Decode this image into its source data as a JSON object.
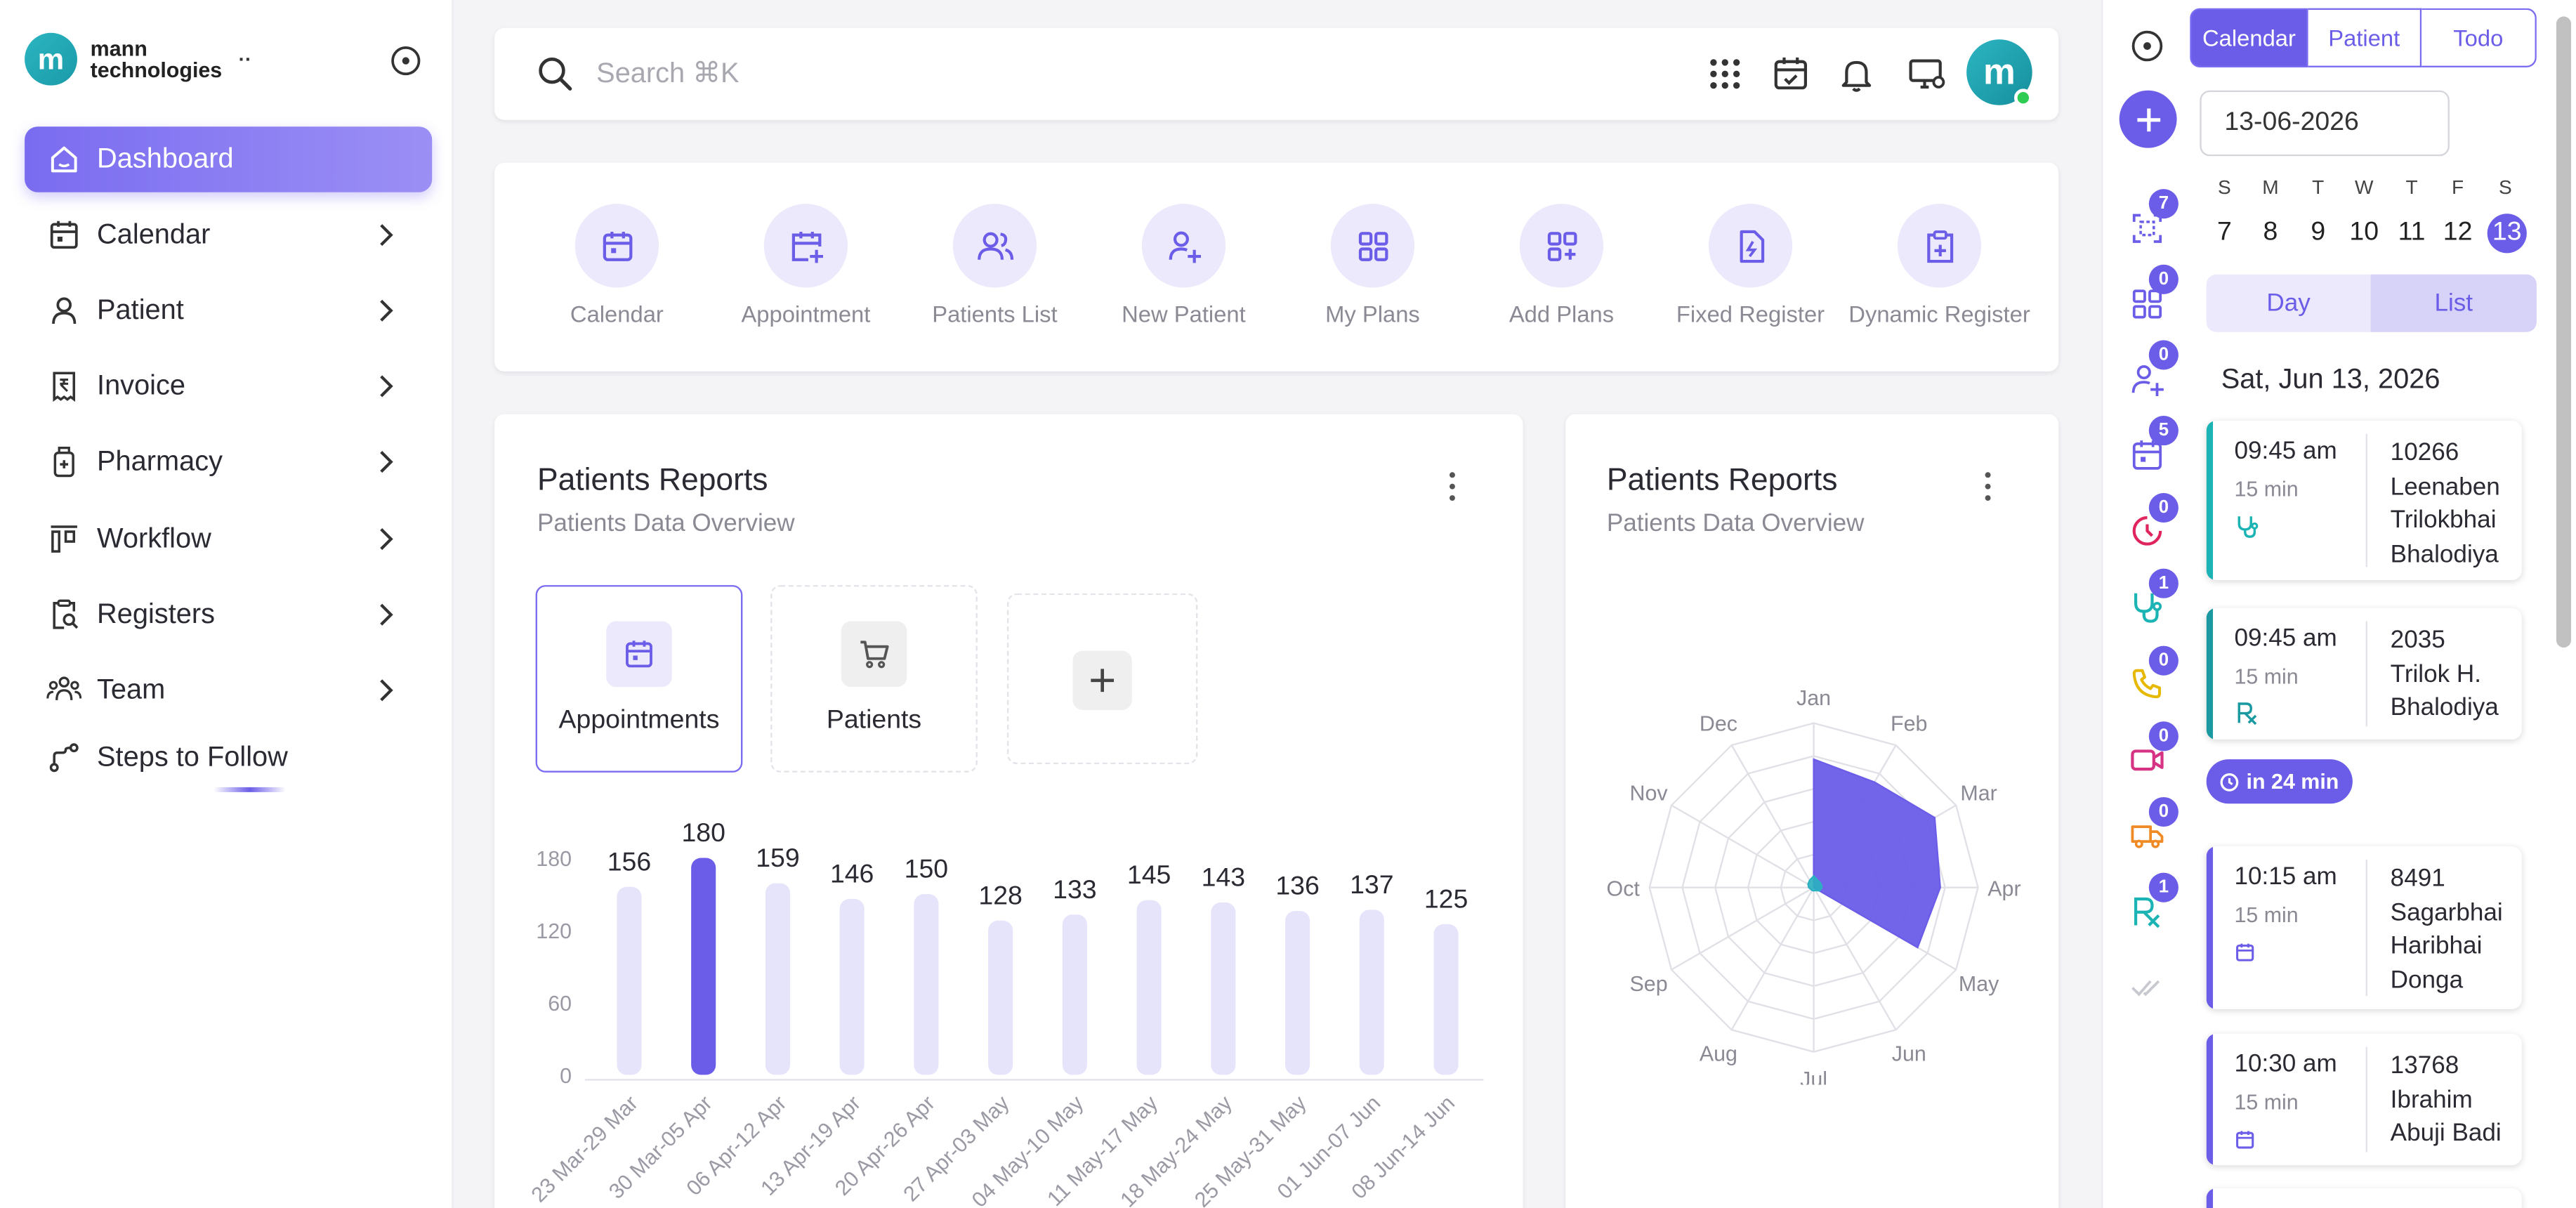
{
  "brand": {
    "logo_letter": "m",
    "name_line1": "mann",
    "name_line2": "technologies",
    "dots": "··"
  },
  "sidebar": {
    "items": [
      {
        "label": "Dashboard",
        "icon": "home-icon"
      },
      {
        "label": "Calendar",
        "icon": "calendar-icon"
      },
      {
        "label": "Patient",
        "icon": "user-icon"
      },
      {
        "label": "Invoice",
        "icon": "invoice-icon"
      },
      {
        "label": "Pharmacy",
        "icon": "pill-bottle-icon"
      },
      {
        "label": "Workflow",
        "icon": "workflow-icon"
      },
      {
        "label": "Registers",
        "icon": "clipboard-search-icon"
      },
      {
        "label": "Team",
        "icon": "team-icon"
      },
      {
        "label": "Steps to Follow",
        "icon": "route-icon"
      }
    ]
  },
  "search": {
    "placeholder": "Search ⌘K"
  },
  "user": {
    "avatar_letter": "m"
  },
  "quick_actions": [
    {
      "label": "Calendar",
      "icon": "calendar-icon"
    },
    {
      "label": "Appointment",
      "icon": "calendar-plus-icon"
    },
    {
      "label": "Patients List",
      "icon": "users-icon"
    },
    {
      "label": "New Patient",
      "icon": "user-plus-icon"
    },
    {
      "label": "My Plans",
      "icon": "grid-icon"
    },
    {
      "label": "Add Plans",
      "icon": "grid-plus-icon"
    },
    {
      "label": "Fixed Register",
      "icon": "file-bolt-icon"
    },
    {
      "label": "Dynamic Register",
      "icon": "clipboard-plus-icon"
    }
  ],
  "reports_card": {
    "title": "Patients Reports",
    "subtitle": "Patients Data Overview",
    "tabs": [
      {
        "label": "Appointments",
        "icon": "calendar-icon"
      },
      {
        "label": "Patients",
        "icon": "cart-icon"
      }
    ]
  },
  "radar_card": {
    "title": "Patients Reports",
    "subtitle": "Patients Data Overview"
  },
  "chart_data": [
    {
      "type": "bar",
      "categories": [
        "23 Mar-29 Mar",
        "30 Mar-05 Apr",
        "06 Apr-12 Apr",
        "13 Apr-19 Apr",
        "20 Apr-26 Apr",
        "27 Apr-03 May",
        "04 May-10 May",
        "11 May-17 May",
        "18 May-24 May",
        "25 May-31 May",
        "01 Jun-07 Jun",
        "08 Jun-14 Jun"
      ],
      "values": [
        156,
        180,
        159,
        146,
        150,
        128,
        133,
        145,
        143,
        136,
        137,
        125
      ],
      "highlight_index": 1,
      "yticks": [
        0,
        60,
        120,
        180
      ],
      "ylim": [
        0,
        180
      ],
      "colors": {
        "bar": "#e6e4fa",
        "highlight": "#6b5de8"
      }
    },
    {
      "type": "radar",
      "categories": [
        "Jan",
        "Feb",
        "Mar",
        "Apr",
        "May",
        "Jun",
        "Jul",
        "Aug",
        "Sep",
        "Oct",
        "Nov",
        "Dec"
      ],
      "series": [
        {
          "values": [
            0.78,
            0.74,
            0.85,
            0.77,
            0.73,
            0,
            0,
            0,
            0,
            0,
            0,
            0
          ],
          "color": "#6b5de8"
        },
        {
          "values": [
            0.07,
            0.05,
            0.05,
            0.05,
            0.04,
            0.02,
            0.02,
            0.02,
            0.02,
            0.03,
            0.04,
            0.05
          ],
          "color": "#2ab0c0"
        }
      ]
    }
  ],
  "right_panel": {
    "tabs": [
      "Calendar",
      "Patient",
      "Todo"
    ],
    "date_value": "13-06-2026",
    "weekdays": [
      "S",
      "M",
      "T",
      "W",
      "T",
      "F",
      "S"
    ],
    "days": [
      "7",
      "8",
      "9",
      "10",
      "11",
      "12",
      "13"
    ],
    "view_tabs": [
      "Day",
      "List"
    ],
    "date_heading": "Sat, Jun 13, 2026",
    "side_icons": [
      {
        "icon": "scan-icon",
        "count": "7",
        "color": "#6b5de8"
      },
      {
        "icon": "grid-icon",
        "count": "0",
        "color": "#6b5de8"
      },
      {
        "icon": "user-plus-icon",
        "count": "0",
        "color": "#6b5de8"
      },
      {
        "icon": "calendar-icon",
        "count": "5",
        "color": "#6b5de8"
      },
      {
        "icon": "timer-icon",
        "count": "0",
        "color": "#e0245e"
      },
      {
        "icon": "stethoscope-icon",
        "count": "1",
        "color": "#1bb3b3"
      },
      {
        "icon": "phone-icon",
        "count": "0",
        "color": "#e6b800"
      },
      {
        "icon": "video-icon",
        "count": "0",
        "color": "#d63384"
      },
      {
        "icon": "truck-icon",
        "count": "0",
        "color": "#f08a24"
      },
      {
        "icon": "rx-icon",
        "count": "1",
        "color": "#1bb3b3"
      }
    ],
    "soon_label": "in 24 min",
    "appointments": [
      {
        "time": "09:45 am",
        "duration": "15 min",
        "id": "10266",
        "name_lines": [
          "Leenaben",
          "Trilokbhai",
          "Bhalodiya"
        ],
        "icon": "stethoscope-icon",
        "accent": "#1bb3b3"
      },
      {
        "time": "09:45 am",
        "duration": "15 min",
        "id": "2035",
        "name_lines": [
          "Trilok H.",
          "Bhalodiya"
        ],
        "icon": "rx-icon",
        "accent": "#1a9aa0"
      },
      {
        "time": "10:15 am",
        "duration": "15 min",
        "id": "8491",
        "name_lines": [
          "Sagarbhai",
          "Haribhai",
          "Donga"
        ],
        "icon": "calendar-icon",
        "accent": "#6b5de8"
      },
      {
        "time": "10:30 am",
        "duration": "15 min",
        "id": "13768",
        "name_lines": [
          "Ibrahim",
          "Abuji Badi"
        ],
        "icon": "calendar-icon",
        "accent": "#6b5de8"
      }
    ]
  }
}
